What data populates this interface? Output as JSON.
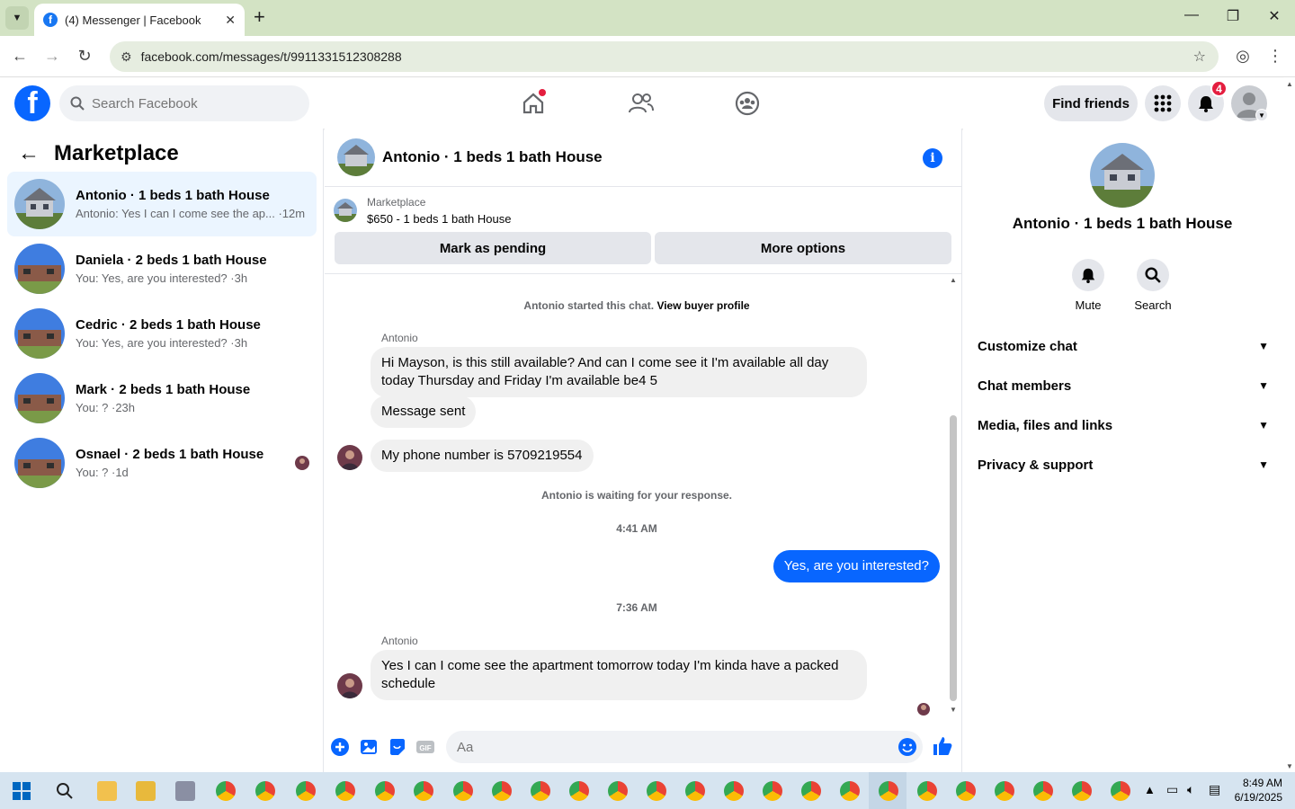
{
  "browser": {
    "tab_title": "(4) Messenger | Facebook",
    "url": "facebook.com/messages/t/9911331512308288"
  },
  "fb_header": {
    "search_placeholder": "Search Facebook",
    "find_friends": "Find friends",
    "notification_count": "4"
  },
  "left_panel": {
    "title": "Marketplace",
    "conversations": [
      {
        "name": "Antonio · 1 beds 1 bath House",
        "preview": "Antonio: Yes I can I come see the ap... ·12m"
      },
      {
        "name": "Daniela · 2 beds 1 bath House",
        "preview": "You: Yes, are you interested? ·3h"
      },
      {
        "name": "Cedric · 2 beds 1 bath House",
        "preview": "You: Yes, are you interested? ·3h"
      },
      {
        "name": "Mark · 2 beds 1 bath House",
        "preview": "You: ? ·23h"
      },
      {
        "name": "Osnael · 2 beds 1 bath House",
        "preview": "You: ? ·1d"
      }
    ]
  },
  "chat": {
    "title": "Antonio · 1 beds 1 bath House",
    "marketplace_label": "Marketplace",
    "listing": "$650 - 1 beds 1 bath House",
    "mark_pending": "Mark as pending",
    "more_options": "More options",
    "started_text": "Antonio started this chat.",
    "view_profile": "View buyer profile",
    "sender1": "Antonio",
    "msg1": "Hi Mayson, is this still available? And can I come see it I'm available all day today Thursday and Friday I'm available be4 5",
    "msg2": "Message sent",
    "msg3": "My phone number is 5709219554",
    "waiting_text": "Antonio is waiting for your response.",
    "time1": "4:41 AM",
    "msg_out": "Yes, are you interested?",
    "time2": "7:36 AM",
    "sender2": "Antonio",
    "msg4": "Yes I can I come see the apartment tomorrow today I'm kinda have a packed schedule",
    "composer_placeholder": "Aa"
  },
  "right_panel": {
    "name": "Antonio · 1 beds 1 bath House",
    "mute": "Mute",
    "search": "Search",
    "rows": [
      "Customize chat",
      "Chat members",
      "Media, files and links",
      "Privacy & support"
    ]
  },
  "taskbar": {
    "time": "8:49 AM",
    "date": "6/19/2025"
  },
  "colors": {
    "fb_blue": "#0866ff",
    "active_conv": "#ebf5ff",
    "badge_red": "#e41e3f"
  }
}
